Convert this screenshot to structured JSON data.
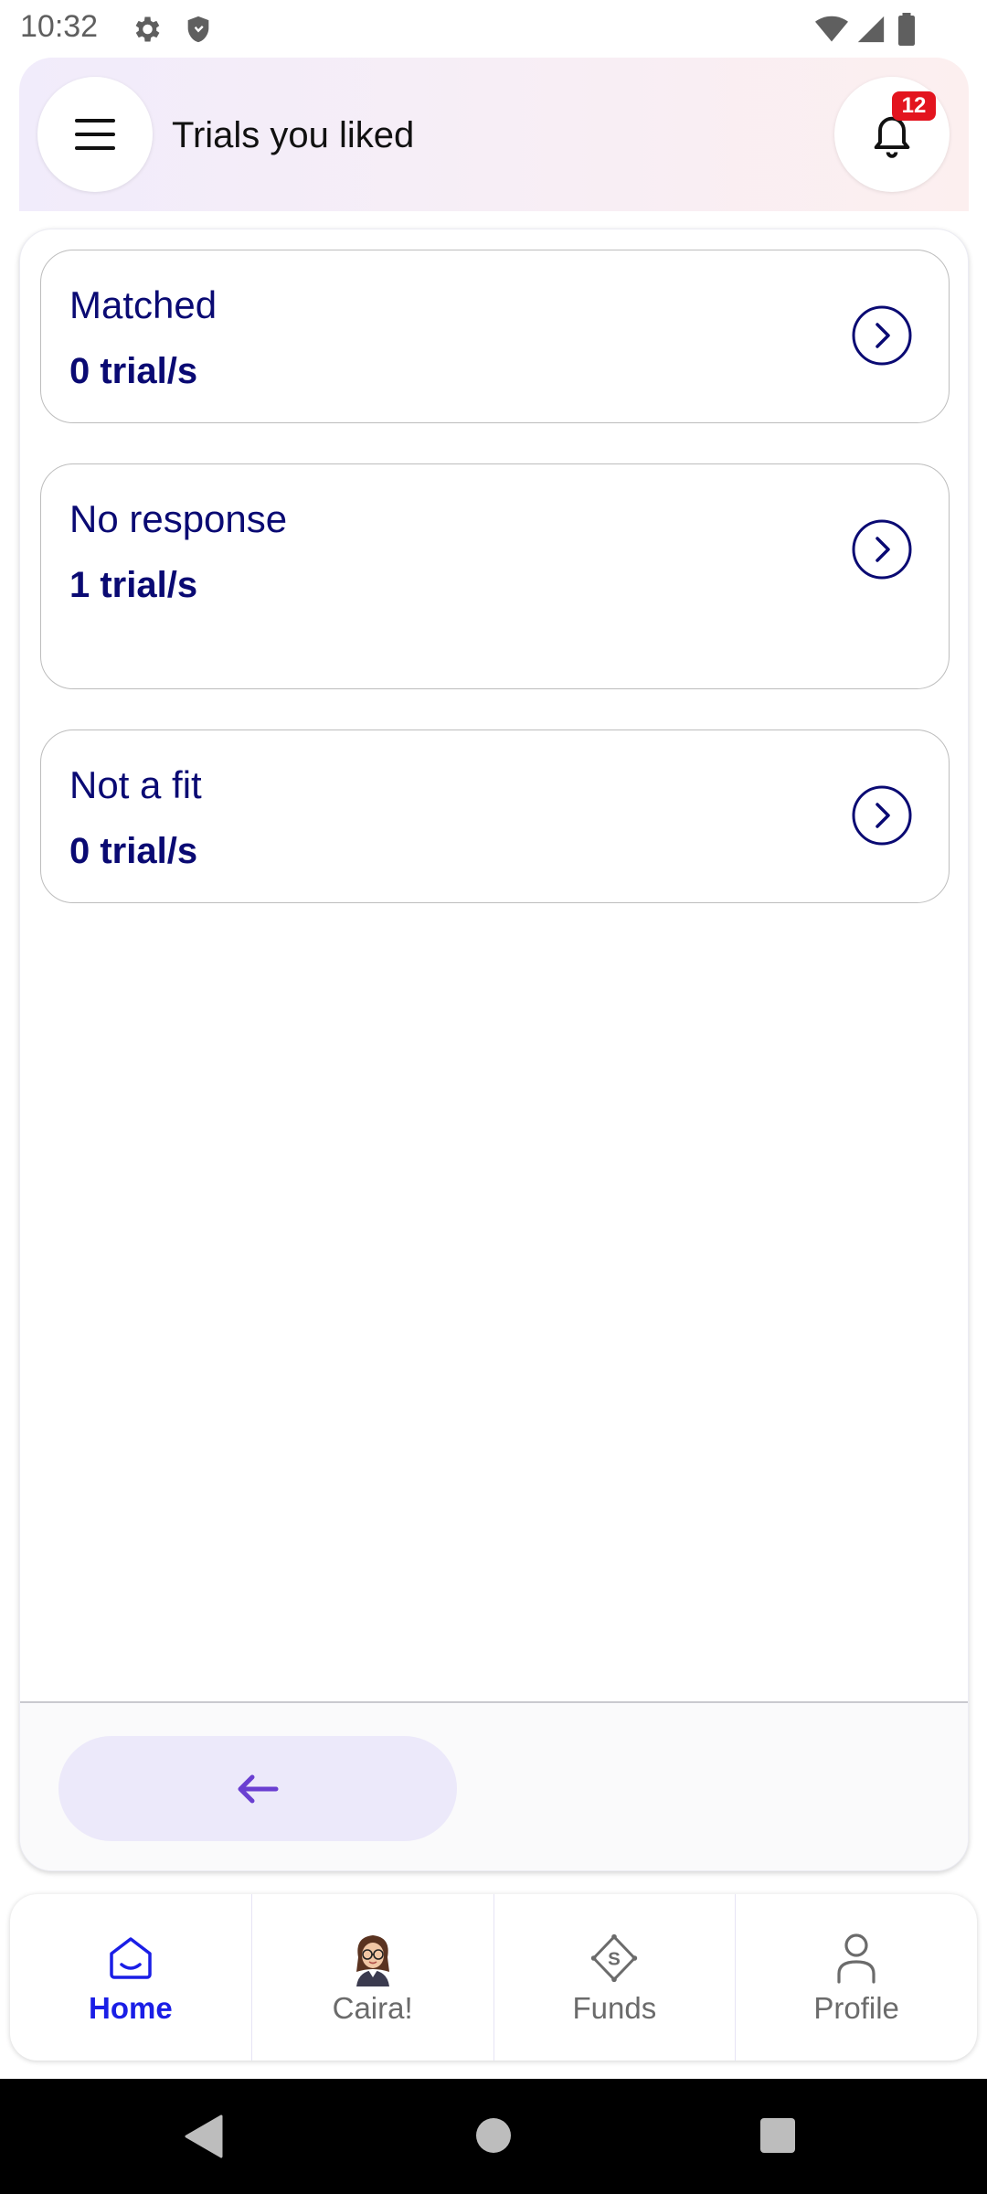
{
  "status_bar": {
    "time": "10:32"
  },
  "header": {
    "title": "Trials you liked",
    "notification_count": "12"
  },
  "cards": [
    {
      "title": "Matched",
      "count": "0 trial/s"
    },
    {
      "title": "No response",
      "count": "1 trial/s"
    },
    {
      "title": "Not a fit",
      "count": "0 trial/s"
    }
  ],
  "nav": {
    "items": [
      {
        "label": "Home",
        "icon": "home-icon",
        "active": true
      },
      {
        "label": "Caira!",
        "icon": "caira-avatar",
        "active": false
      },
      {
        "label": "Funds",
        "icon": "funds-icon",
        "active": false
      },
      {
        "label": "Profile",
        "icon": "profile-icon",
        "active": false
      }
    ]
  },
  "colors": {
    "accent": "#0a0a73",
    "active_nav": "#1a1ee6",
    "badge": "#e3141e",
    "back_button_bg": "#ece9fa",
    "back_arrow": "#6a3fd1"
  }
}
